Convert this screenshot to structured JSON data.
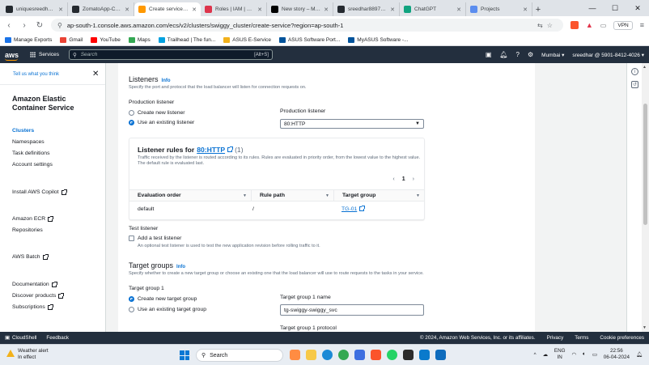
{
  "browser": {
    "tabs": [
      {
        "label": "uniquesreedhar/Swi",
        "color": "#24292f",
        "active": false
      },
      {
        "label": "ZomatoApp-Clone/G",
        "color": "#24292f",
        "active": false
      },
      {
        "label": "Create service | E",
        "color": "#ff9900",
        "active": true
      },
      {
        "label": "Roles | IAM | Global",
        "color": "#dd344c",
        "active": false
      },
      {
        "label": "New story – Medium",
        "color": "#000000",
        "active": false
      },
      {
        "label": "sreedhar8897/swigg",
        "color": "#24292f",
        "active": false
      },
      {
        "label": "ChatGPT",
        "color": "#10a37f",
        "active": false
      },
      {
        "label": "Projects",
        "color": "#5b8def",
        "active": false
      }
    ],
    "url": "ap-south-1.console.aws.amazon.com/ecs/v2/clusters/swiggy_cluster/create-service?region=ap-south-1",
    "vpn_label": "VPN",
    "bookmarks": [
      {
        "label": "Manage Exports",
        "color": "#1a73e8"
      },
      {
        "label": "Gmail",
        "color": "#ea4335"
      },
      {
        "label": "YouTube",
        "color": "#ff0000"
      },
      {
        "label": "Maps",
        "color": "#34a853"
      },
      {
        "label": "Trailhead | The fun...",
        "color": "#00a1e0"
      },
      {
        "label": "ASUS E-Service",
        "color": "#f2b11b"
      },
      {
        "label": "ASUS Software Port...",
        "color": "#00539b"
      },
      {
        "label": "MyASUS Software -...",
        "color": "#00539b"
      }
    ]
  },
  "aws_header": {
    "logo": "aws",
    "services": "Services",
    "search_placeholder": "Search",
    "search_shortcut": "[Alt+S]",
    "region": "Mumbai ▾",
    "account": "sreedhar @ 5901-8412-4026 ▾"
  },
  "leftnav": {
    "tell_us": "Tell us what you think",
    "service_name": "Amazon Elastic Container Service",
    "items": [
      {
        "label": "Clusters",
        "active": true,
        "external": false
      },
      {
        "label": "Namespaces",
        "active": false,
        "external": false
      },
      {
        "label": "Task definitions",
        "active": false,
        "external": false
      },
      {
        "label": "Account settings",
        "active": false,
        "external": false
      },
      {
        "label": "Install AWS Copilot",
        "active": false,
        "external": true
      },
      {
        "label": "Amazon ECR",
        "active": false,
        "external": true
      },
      {
        "label": "Repositories",
        "active": false,
        "external": false
      },
      {
        "label": "AWS Batch",
        "active": false,
        "external": true
      },
      {
        "label": "Documentation",
        "active": false,
        "external": true
      },
      {
        "label": "Discover products",
        "active": false,
        "external": true
      },
      {
        "label": "Subscriptions",
        "active": false,
        "external": true
      }
    ]
  },
  "listeners": {
    "title": "Listeners",
    "info": "Info",
    "desc": "Specify the port and protocol that the load balancer will listen for connection requests on.",
    "production_listener_label": "Production listener",
    "option_create": "Create new listener",
    "option_existing": "Use an existing listener",
    "selected_option": "existing",
    "select_label": "Production listener",
    "select_value": "80:HTTP",
    "rules": {
      "title_prefix": "Listener rules for",
      "title_link": "80:HTTP",
      "count": "(1)",
      "desc": "Traffic received by the listener is routed according to its rules. Rules are evaluated in priority order, from the lowest value to the highest value. The default rule is evaluated last.",
      "page": "1",
      "columns": [
        "Evaluation order",
        "Rule path",
        "Target group"
      ],
      "rows": [
        {
          "order": "default",
          "path": "/",
          "target": "TG-01"
        }
      ]
    },
    "test_listener_label": "Test listener",
    "test_checkbox": "Add a test listener",
    "test_desc": "An optional test listener is used to test the new application revision before rolling traffic to it."
  },
  "target_groups": {
    "title": "Target groups",
    "info": "Info",
    "desc": "Specify whether to create a new target group or choose an existing one that the load balancer will use to route requests to the tasks in your service.",
    "group_label": "Target group 1",
    "option_create": "Create new target group",
    "option_existing": "Use an existing target group",
    "selected_option": "create",
    "name_label": "Target group 1 name",
    "name_value": "tg-swiggy-swiggy_svc",
    "protocol_label": "Target group 1 protocol"
  },
  "footer": {
    "cloudshell": "CloudShell",
    "feedback": "Feedback",
    "copyright": "© 2024, Amazon Web Services, Inc. or its affiliates.",
    "privacy": "Privacy",
    "terms": "Terms",
    "cookies": "Cookie preferences"
  },
  "taskbar": {
    "weather_title": "Weather alert",
    "weather_sub": "In effect",
    "search": "Search",
    "lang_1": "ENG",
    "lang_2": "IN",
    "time": "22:56",
    "date": "06-04-2024"
  }
}
